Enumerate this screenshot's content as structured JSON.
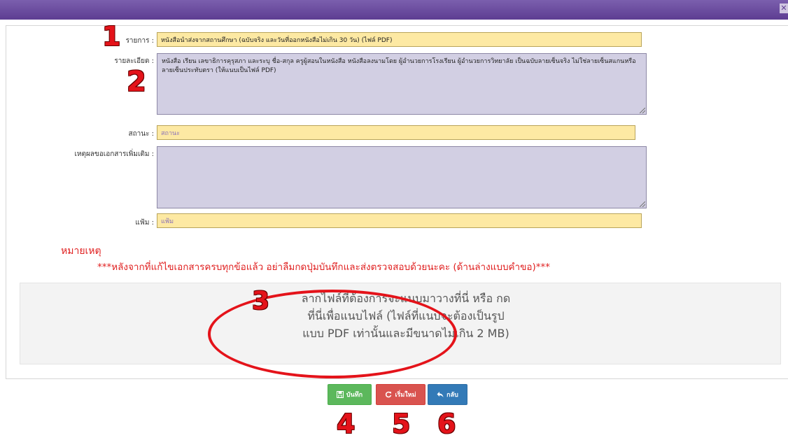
{
  "window": {
    "close_symbol": "✕"
  },
  "form": {
    "item_label": "รายการ :",
    "item_value": "หนังสือนำส่งจากสถานศึกษา (ฉบับจริง และวันที่ออกหนังสือไม่เกิน 30 วัน) (ไฟล์ PDF)",
    "detail_label": "รายละเอียด :",
    "detail_value": "หนังสือ เรียน เลขาธิการคุรุสภา และระบุ ชื่อ-สกุล ครูผู้สอนในหนังสือ หนังสือลงนามโดย ผู้อำนวยการโรงเรียน ผู้อำนวยการวิทยาลัย เป็นฉบับลายเซ็นจริง ไม่ใช่ลายเซ็นสแกนหรือลายเซ็นประทับตรา (ให้แนบเป็นไฟล์ PDF)",
    "status_label": "สถานะ :",
    "status_placeholder": "สถานะ",
    "reason_label": "เหตุผลขอเอกสารเพิ่มเติม :",
    "reason_value": "",
    "file_label": "แฟ้ม :",
    "file_placeholder": "แฟ้ม"
  },
  "note": {
    "title": "หมายเหตุ",
    "text": "***หลังจากที่แก้ไขเอกสารครบทุกข้อแล้ว อย่าลืมกดปุ่มบันทึกและส่งตรวจสอบด้วยนะคะ (ด้านล่างแบบคำขอ)***"
  },
  "dropzone": {
    "line1": "ลากไฟล์ที่ต้องการจะแนบมาวางที่นี่ หรือ กด",
    "line2": "ที่นี่เพื่อแนบไฟล์ (ไฟล์ที่แนบจะต้องเป็นรูป",
    "line3": "แบบ PDF เท่านั้นและมีขนาดไม่เกิน 2 MB)"
  },
  "buttons": {
    "save": "บันทึก",
    "reset": "เริ่มใหม่",
    "back": "กลับ"
  },
  "annotations": {
    "n1": "1",
    "n2": "2",
    "n3": "3",
    "n4": "4",
    "n5": "5",
    "n6": "6"
  },
  "colors": {
    "header": "#5d3d92",
    "save": "#5cb85c",
    "reset": "#d9534f",
    "back": "#337ab7",
    "annotation": "#e4131a"
  }
}
